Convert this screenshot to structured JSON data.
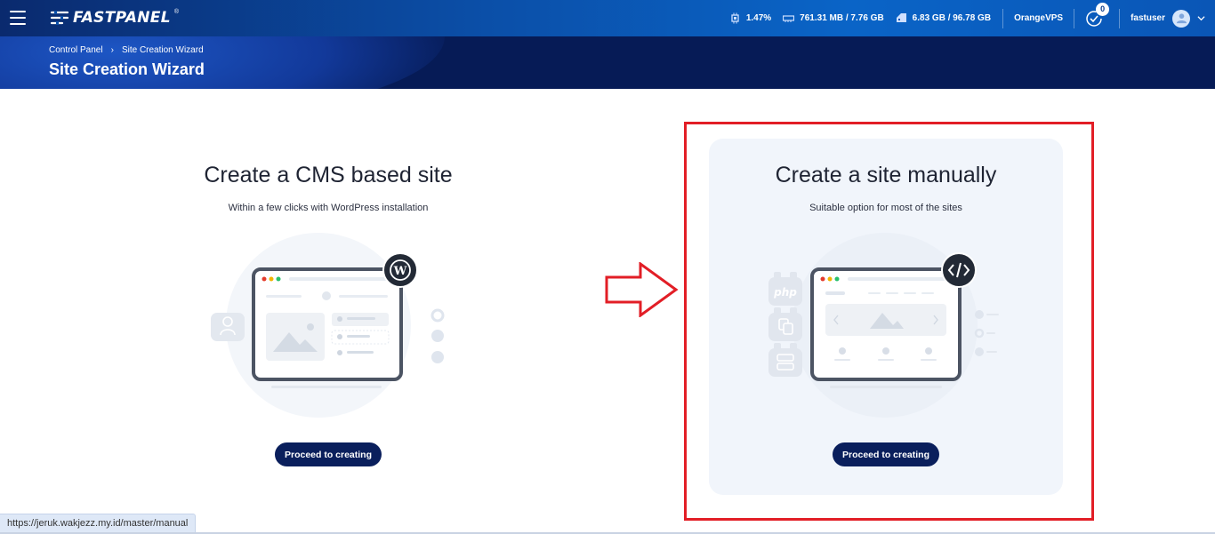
{
  "topbar": {
    "brand": "FASTPANEL",
    "brand_mark": "®",
    "cpu": "1.47%",
    "memory": "761.31 MB / 7.76 GB",
    "disk": "6.83 GB / 96.78 GB",
    "server": "OrangeVPS",
    "notifications_count": "0",
    "username": "fastuser"
  },
  "header": {
    "breadcrumb": [
      "Control Panel",
      "Site Creation Wizard"
    ],
    "breadcrumb_separator": "›",
    "title": "Site Creation Wizard"
  },
  "cards": {
    "cms": {
      "title": "Create a CMS based site",
      "subtitle": "Within a few clicks with WordPress installation",
      "button": "Proceed to creating"
    },
    "manual": {
      "title": "Create a site manually",
      "subtitle": "Suitable option for most of the sites",
      "button": "Proceed to creating",
      "php_label": "php"
    }
  },
  "status_url": "https://jeruk.wakjezz.my.id/master/manual",
  "colors": {
    "primary_dark": "#0a1f5c",
    "topbar": "#0b4fa8",
    "highlight": "#e21e26",
    "card_bg": "#f1f5fb"
  }
}
